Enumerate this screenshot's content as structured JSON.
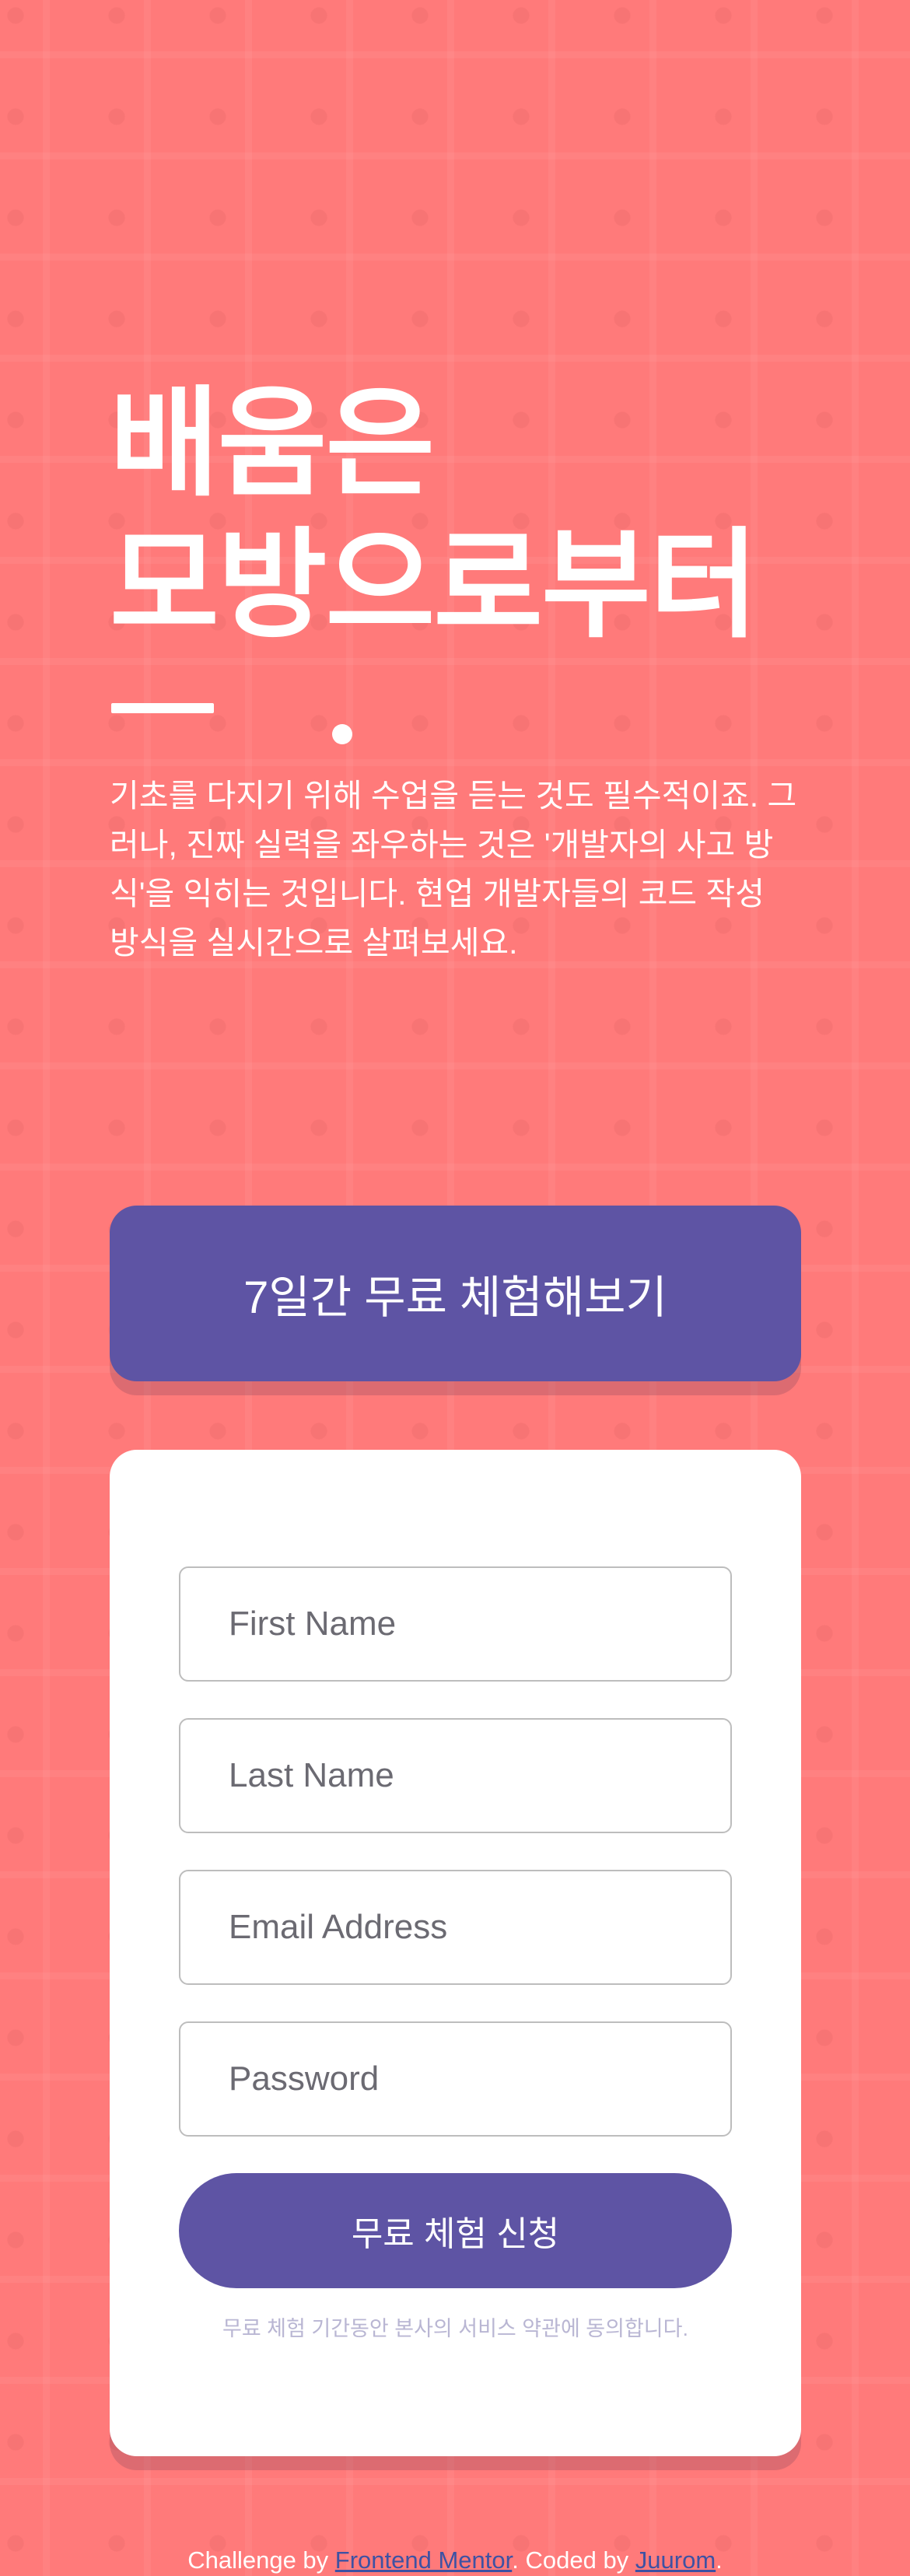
{
  "hero": {
    "title_line1": "배움은",
    "title_line2": "모방으로부터",
    "description": "기초를 다지기 위해 수업을 듣는 것도 필수적이죠. 그러나, 진짜 실력을 좌우하는 것은 '개발자의 사고 방식'을 익히는 것입니다. 현업 개발자들의 코드 작성 방식을 실시간으로 살펴보세요."
  },
  "trial_banner": {
    "label": "7일간 무료 체험해보기"
  },
  "form": {
    "first_name_placeholder": "First Name",
    "last_name_placeholder": "Last Name",
    "email_placeholder": "Email Address",
    "password_placeholder": "Password",
    "submit_label": "무료 체험 신청",
    "terms_text": "무료 체험 기간동안 본사의 서비스 약관에 동의합니다."
  },
  "footer": {
    "prefix": "Challenge by ",
    "link1": "Frontend Mentor",
    "middle": ". Coded by ",
    "link2": "Juurom",
    "suffix": "."
  },
  "colors": {
    "background": "#ff7a7a",
    "accent": "#5e54a4",
    "link": "#3e52a3"
  }
}
